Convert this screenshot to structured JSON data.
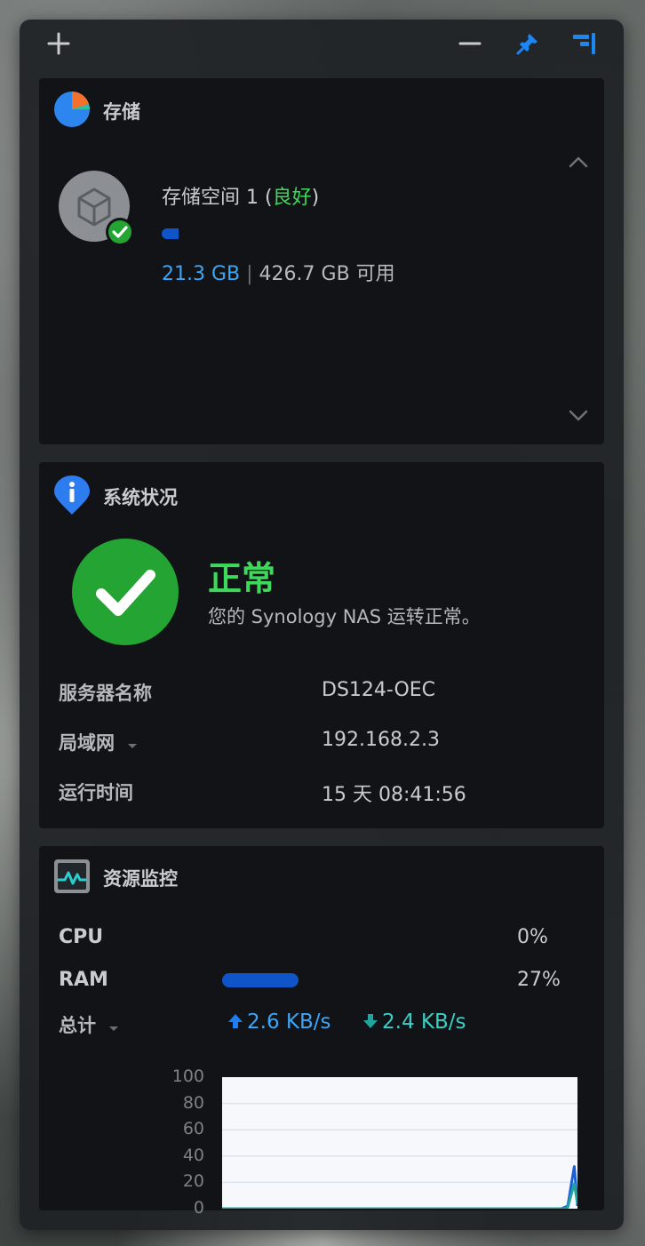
{
  "colors": {
    "accent_blue": "#1d86f5",
    "ok_green": "#23a433",
    "good_text": "#3ed85a",
    "used_blue": "#3da5f5",
    "ram_bar": "#0f55c9",
    "upload": "#1f7ff0",
    "download": "#1fa59e"
  },
  "toolbar": {
    "add_icon": "plus-icon",
    "minimize_icon": "minus-icon",
    "pin_icon": "pin-icon",
    "collapse_icon": "panel-collapse-icon"
  },
  "storage": {
    "title": "存储",
    "volume_name": "存储空间 1 (",
    "volume_status": "良好",
    "volume_close": ")",
    "used": "21.3 GB",
    "separator": "|",
    "available": "426.7 GB 可用",
    "usage_percent": 4.8
  },
  "system": {
    "title": "系统状况",
    "status": "正常",
    "message": "您的 Synology NAS 运转正常。",
    "rows": [
      {
        "label": "服务器名称",
        "value": "DS124-OEC"
      },
      {
        "label": "局域网",
        "value": "192.168.2.3"
      },
      {
        "label": "运行时间",
        "value": "15 天 08:41:56"
      }
    ]
  },
  "resource": {
    "title": "资源监控",
    "cpu_label": "CPU",
    "cpu_value": "0%",
    "cpu_percent": 0,
    "ram_label": "RAM",
    "ram_value": "27%",
    "ram_percent": 27,
    "net_label": "总计",
    "upload": "2.6 KB/s",
    "download": "2.4 KB/s"
  },
  "chart_data": {
    "type": "line",
    "ylim": [
      0,
      100
    ],
    "y_ticks": [
      "100",
      "80",
      "60",
      "40",
      "20",
      "0"
    ],
    "series": [
      {
        "values": [
          0,
          0,
          0,
          0,
          0,
          0,
          0,
          0,
          0,
          0,
          0,
          0,
          0,
          0,
          0,
          0,
          0,
          0,
          0,
          0,
          0,
          0,
          0,
          0,
          0,
          0,
          0,
          0,
          0,
          0,
          0,
          0,
          0,
          0,
          0,
          0,
          0,
          0,
          0,
          0,
          0,
          0,
          0,
          0,
          0,
          0,
          0,
          0,
          0,
          0,
          0,
          0,
          0,
          0,
          0,
          0,
          0,
          0,
          0,
          0,
          0,
          0,
          0,
          0,
          0,
          0,
          0,
          0,
          0,
          0,
          0,
          0,
          0,
          0,
          0,
          0,
          0,
          0,
          0,
          0,
          0,
          0,
          0,
          0,
          0,
          0,
          0,
          0,
          0,
          0,
          0,
          0,
          0,
          0,
          0,
          0,
          0,
          0,
          0,
          0,
          0,
          0,
          0,
          0,
          0,
          0,
          1,
          2,
          17,
          32,
          2
        ]
      },
      {
        "values": [
          0,
          0,
          0,
          0,
          0,
          0,
          0,
          0,
          0,
          0,
          0,
          0,
          0,
          0,
          0,
          0,
          0,
          0,
          0,
          0,
          0,
          0,
          0,
          0,
          0,
          0,
          0,
          0,
          0,
          0,
          0,
          0,
          0,
          0,
          0,
          0,
          0,
          0,
          0,
          0,
          0,
          0,
          0,
          0,
          0,
          0,
          0,
          0,
          0,
          0,
          0,
          0,
          0,
          0,
          0,
          0,
          0,
          0,
          0,
          0,
          0,
          0,
          0,
          0,
          0,
          0,
          0,
          0,
          0,
          0,
          0,
          0,
          0,
          0,
          0,
          0,
          0,
          0,
          0,
          0,
          0,
          0,
          0,
          0,
          0,
          0,
          0,
          0,
          0,
          0,
          0,
          0,
          0,
          0,
          0,
          0,
          0,
          0,
          0,
          0,
          0,
          0,
          0,
          0,
          0,
          0,
          0,
          1,
          10,
          19,
          4
        ]
      }
    ]
  }
}
